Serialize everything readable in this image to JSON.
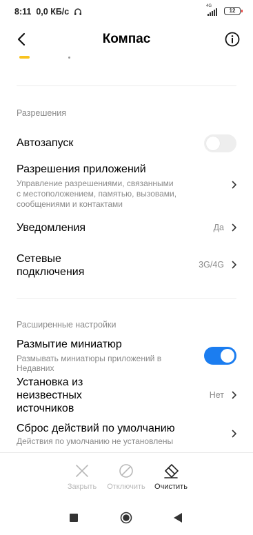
{
  "status_bar": {
    "time": "8:11",
    "speed": "0,0 КБ/с",
    "network_type": "4G",
    "battery": "12",
    "battery_tip_color": "#e53935"
  },
  "header": {
    "title": "Компас",
    "back_icon": "arrow-back-icon",
    "info_icon": "info-circle-icon"
  },
  "permissions": {
    "section_title": "Разрешения",
    "autostart": {
      "title": "Автозапуск",
      "enabled": false
    },
    "app_permissions": {
      "title": "Разрешения приложений",
      "subtitle_lines": [
        "Управление разрешениями, связанными",
        "с местоположением, памятью, вызовами,",
        "сообщениями и контактами"
      ]
    },
    "notifications": {
      "title": "Уведомления",
      "value": "Да"
    },
    "network": {
      "title_lines": [
        "Сетевые",
        "подключения"
      ],
      "value": "3G/4G"
    }
  },
  "advanced": {
    "section_title": "Расширенные настройки",
    "blur": {
      "title": "Размытие миниатюр",
      "subtitle_lines": [
        "Размывать миниатюры приложений в",
        "Недавних"
      ],
      "enabled": true
    },
    "unknown_sources": {
      "title_lines": [
        "Установка из",
        "неизвестных",
        "источников"
      ],
      "value": "Нет"
    },
    "reset_defaults": {
      "title": "Сброс действий по умолчанию",
      "subtitle": "Действия по умолчанию не установлены"
    }
  },
  "actions": {
    "close": {
      "label": "Закрыть",
      "icon": "close-x-icon",
      "enabled": false
    },
    "disable": {
      "label": "Отключить",
      "icon": "block-icon",
      "enabled": false
    },
    "clear": {
      "label": "Очистить",
      "icon": "eraser-icon",
      "enabled": true
    }
  },
  "colors": {
    "accent": "#1b7df0",
    "yellow": "#f9c31f",
    "secondary_text": "#8a8a8a"
  }
}
